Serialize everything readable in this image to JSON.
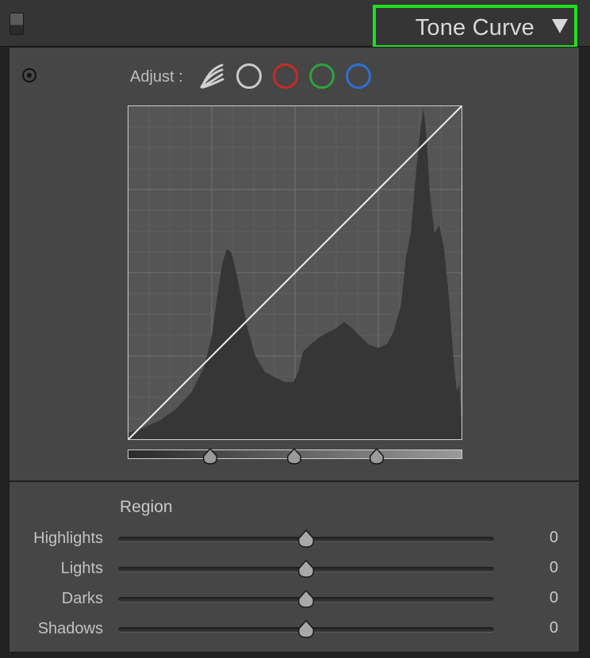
{
  "header": {
    "title": "Tone Curve",
    "collapse_icon": "triangle-down-icon",
    "solo_icon": "panel-switch-icon",
    "highlight_color": "#1fe01f"
  },
  "adjust": {
    "label": "Adjust :",
    "channels": [
      {
        "name": "parametric",
        "icon": "parametric-curve-icon"
      },
      {
        "name": "rgb",
        "icon": "point-curve-icon",
        "color": "#c9c9c9"
      },
      {
        "name": "red",
        "icon": "red-channel-icon",
        "color": "#c72a2a"
      },
      {
        "name": "green",
        "icon": "green-channel-icon",
        "color": "#2fa23f"
      },
      {
        "name": "blue",
        "icon": "blue-channel-icon",
        "color": "#2f6fd8"
      }
    ]
  },
  "curve": {
    "type": "linear",
    "points": [
      [
        0,
        0
      ],
      [
        255,
        255
      ]
    ]
  },
  "region": {
    "label": "Region",
    "sliders": [
      {
        "label": "Highlights",
        "value": "0",
        "level": 0.5
      },
      {
        "label": "Lights",
        "value": "0",
        "level": 0.5
      },
      {
        "label": "Darks",
        "value": "0",
        "level": 0.5
      },
      {
        "label": "Shadows",
        "value": "0",
        "level": 0.5
      }
    ]
  },
  "split_points": [
    0.25,
    0.5,
    0.75
  ]
}
